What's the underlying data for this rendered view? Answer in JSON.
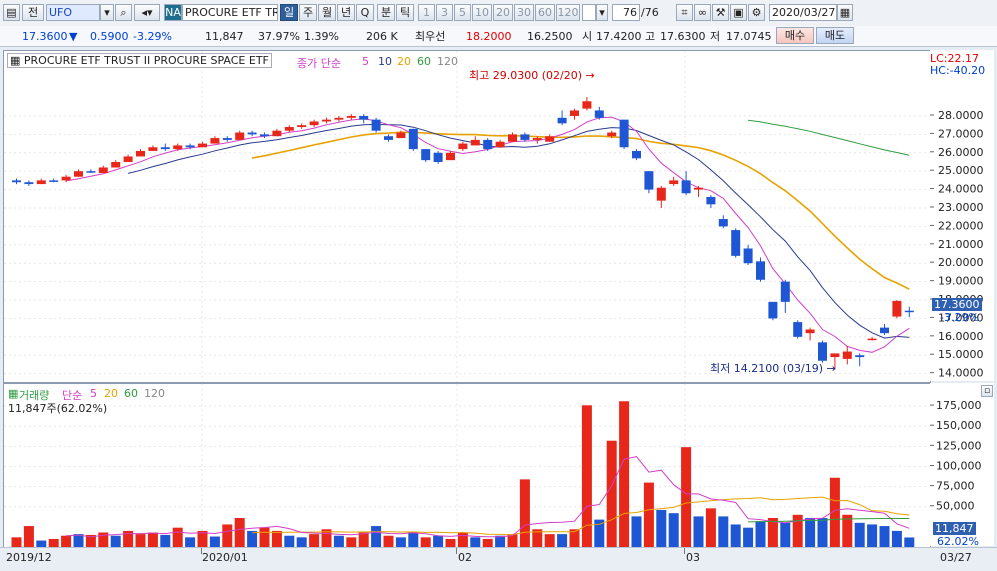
{
  "toolbar": {
    "chart_icon": "chart-icon",
    "period_label": "전",
    "symbol": "UFO",
    "market": "NA",
    "name": "PROCURE ETF TRUS",
    "tabs": [
      "일",
      "주",
      "월",
      "년",
      "Q",
      "분",
      "틱"
    ],
    "active_tab": "일",
    "intervals": [
      "1",
      "3",
      "5",
      "10",
      "20",
      "30",
      "60",
      "120"
    ],
    "count": "76",
    "count_total": "/76",
    "date": "2020/03/27"
  },
  "quote": {
    "price": "17.3600",
    "change": "0.5900",
    "change_pct": "-3.29%",
    "volume": "11,847",
    "vol_ratio": "37.97%",
    "rate": "1.39%",
    "turnover": "206 K",
    "bid_label": "최우선",
    "bid": "18.2000",
    "ask": "16.2500",
    "open_label": "시",
    "open": "17.4200",
    "high_label": "고",
    "high": "17.6300",
    "low_label": "저",
    "low": "17.0745",
    "buy_label": "매수",
    "sell_label": "매도"
  },
  "price_panel": {
    "title": "PROCURE ETF TRUST II PROCURE SPACE ETF",
    "legend_head": "종가 단순",
    "ma": [
      "5",
      "10",
      "20",
      "60",
      "120"
    ],
    "lc": "LC:22.17",
    "hc": "HC:-40.20",
    "high_note": "최고 29.0300 (02/20)",
    "low_note": "최저 14.2100 (03/19)",
    "last_price": "17.3600",
    "last_pct": "-3.29%"
  },
  "volume_panel": {
    "legend_head": "거래량",
    "legend_ma_head": "단순",
    "ma": [
      "5",
      "20",
      "60",
      "120"
    ],
    "info": "11,847주(62.02%)",
    "last_volume": "11,847",
    "last_pct": "62.02%"
  },
  "x_labels": [
    "2019/12",
    "2020/01",
    "02",
    "03",
    "03/27"
  ],
  "colors": {
    "up": "#e8271b",
    "down": "#1f56d4",
    "ma5": "#d23ec8",
    "ma10": "#2a3a8c",
    "ma20": "#e8a200",
    "ma60": "#2f9e3f"
  },
  "chart_data": {
    "type": "candlestick",
    "price_ylim": [
      13.6,
      29.9
    ],
    "price_ticks": [
      "14.0000",
      "15.0000",
      "16.0000",
      "17.0000",
      "18.0000",
      "19.0000",
      "20.0000",
      "21.0000",
      "22.0000",
      "23.0000",
      "24.0000",
      "25.0000",
      "26.0000",
      "27.0000",
      "28.0000"
    ],
    "volume_ylim": [
      0,
      190000
    ],
    "volume_ticks": [
      "50,000",
      "75,000",
      "100,000",
      "125,000",
      "150,000",
      "175,000"
    ],
    "candles": [
      [
        24.5,
        24.6,
        24.3,
        24.4
      ],
      [
        24.4,
        24.5,
        24.2,
        24.3
      ],
      [
        24.3,
        24.6,
        24.3,
        24.5
      ],
      [
        24.5,
        24.6,
        24.4,
        24.45
      ],
      [
        24.5,
        24.8,
        24.4,
        24.7
      ],
      [
        24.7,
        25.1,
        24.7,
        25.0
      ],
      [
        25.0,
        25.1,
        24.9,
        24.95
      ],
      [
        24.9,
        25.3,
        24.9,
        25.2
      ],
      [
        25.2,
        25.6,
        25.2,
        25.5
      ],
      [
        25.5,
        25.9,
        25.5,
        25.8
      ],
      [
        25.8,
        26.2,
        25.8,
        26.1
      ],
      [
        26.1,
        26.4,
        26.1,
        26.3
      ],
      [
        26.3,
        26.5,
        26.1,
        26.2
      ],
      [
        26.2,
        26.5,
        26.1,
        26.4
      ],
      [
        26.4,
        26.5,
        26.2,
        26.3
      ],
      [
        26.3,
        26.6,
        26.3,
        26.5
      ],
      [
        26.5,
        26.9,
        26.5,
        26.8
      ],
      [
        26.8,
        26.9,
        26.6,
        26.7
      ],
      [
        26.7,
        27.2,
        26.7,
        27.1
      ],
      [
        27.1,
        27.2,
        26.9,
        27.0
      ],
      [
        27.0,
        27.1,
        26.8,
        26.9
      ],
      [
        26.9,
        27.3,
        26.9,
        27.2
      ],
      [
        27.2,
        27.5,
        27.1,
        27.4
      ],
      [
        27.4,
        27.6,
        27.3,
        27.5
      ],
      [
        27.5,
        27.8,
        27.4,
        27.7
      ],
      [
        27.7,
        27.9,
        27.6,
        27.8
      ],
      [
        27.8,
        28.0,
        27.7,
        27.9
      ],
      [
        27.9,
        28.1,
        27.8,
        28.0
      ],
      [
        28.0,
        28.1,
        27.6,
        27.8
      ],
      [
        27.8,
        27.9,
        27.1,
        27.2
      ],
      [
        26.9,
        27.0,
        26.6,
        26.7
      ],
      [
        26.8,
        27.2,
        26.8,
        27.1
      ],
      [
        27.3,
        27.3,
        26.1,
        26.2
      ],
      [
        26.2,
        26.2,
        25.5,
        25.6
      ],
      [
        26.0,
        26.1,
        25.4,
        25.5
      ],
      [
        25.6,
        26.1,
        25.6,
        26.0
      ],
      [
        26.2,
        26.6,
        26.1,
        26.5
      ],
      [
        26.4,
        26.9,
        26.4,
        26.7
      ],
      [
        26.7,
        26.8,
        26.1,
        26.2
      ],
      [
        26.3,
        26.7,
        26.3,
        26.6
      ],
      [
        26.6,
        27.1,
        26.6,
        27.0
      ],
      [
        27.0,
        27.1,
        26.6,
        26.7
      ],
      [
        26.7,
        26.9,
        26.5,
        26.8
      ],
      [
        26.6,
        27.0,
        26.6,
        26.9
      ],
      [
        27.9,
        28.3,
        27.5,
        27.6
      ],
      [
        28.0,
        28.4,
        27.8,
        28.3
      ],
      [
        28.4,
        29.03,
        28.3,
        28.8
      ],
      [
        28.3,
        28.5,
        27.8,
        27.9
      ],
      [
        26.9,
        27.2,
        26.8,
        27.1
      ],
      [
        27.8,
        27.8,
        26.2,
        26.3
      ],
      [
        26.1,
        26.2,
        25.6,
        25.7
      ],
      [
        25.0,
        25.0,
        23.8,
        24.0
      ],
      [
        23.4,
        24.2,
        23.0,
        24.1
      ],
      [
        24.3,
        24.7,
        24.2,
        24.5
      ],
      [
        24.5,
        25.0,
        23.7,
        23.8
      ],
      [
        24.0,
        24.2,
        23.6,
        24.1
      ],
      [
        23.6,
        23.7,
        23.0,
        23.2
      ],
      [
        22.4,
        22.6,
        21.9,
        22.0
      ],
      [
        21.8,
        21.9,
        20.3,
        20.4
      ],
      [
        20.8,
        21.0,
        19.9,
        20.0
      ],
      [
        20.1,
        20.3,
        19.0,
        19.1
      ],
      [
        17.9,
        17.9,
        16.9,
        17.0
      ],
      [
        19.0,
        19.1,
        17.3,
        17.9
      ],
      [
        16.8,
        16.9,
        15.9,
        16.0
      ],
      [
        16.2,
        16.5,
        15.8,
        16.4
      ],
      [
        15.7,
        15.8,
        14.6,
        14.7
      ],
      [
        14.9,
        15.1,
        14.21,
        15.1
      ],
      [
        14.8,
        15.5,
        14.5,
        15.2
      ],
      [
        15.0,
        15.1,
        14.4,
        14.9
      ],
      [
        15.9,
        16.0,
        15.8,
        15.9
      ],
      [
        16.5,
        16.7,
        16.1,
        16.2
      ],
      [
        17.1,
        18.0,
        17.0,
        17.95
      ],
      [
        17.42,
        17.63,
        17.0745,
        17.36
      ]
    ],
    "volumes": [
      [
        12000,
        "up"
      ],
      [
        26000,
        "up"
      ],
      [
        8000,
        "down"
      ],
      [
        10000,
        "up"
      ],
      [
        14000,
        "up"
      ],
      [
        16000,
        "down"
      ],
      [
        15000,
        "up"
      ],
      [
        18000,
        "up"
      ],
      [
        14000,
        "down"
      ],
      [
        20000,
        "up"
      ],
      [
        16000,
        "up"
      ],
      [
        18000,
        "up"
      ],
      [
        15000,
        "down"
      ],
      [
        24000,
        "up"
      ],
      [
        12000,
        "down"
      ],
      [
        20000,
        "up"
      ],
      [
        13000,
        "down"
      ],
      [
        28000,
        "up"
      ],
      [
        36000,
        "up"
      ],
      [
        20000,
        "down"
      ],
      [
        24000,
        "up"
      ],
      [
        20000,
        "up"
      ],
      [
        14000,
        "down"
      ],
      [
        12000,
        "down"
      ],
      [
        16000,
        "up"
      ],
      [
        22000,
        "up"
      ],
      [
        14000,
        "down"
      ],
      [
        12000,
        "up"
      ],
      [
        18000,
        "up"
      ],
      [
        26000,
        "down"
      ],
      [
        14000,
        "up"
      ],
      [
        12000,
        "down"
      ],
      [
        18000,
        "down"
      ],
      [
        12000,
        "up"
      ],
      [
        14000,
        "down"
      ],
      [
        10000,
        "up"
      ],
      [
        18000,
        "up"
      ],
      [
        12000,
        "down"
      ],
      [
        10000,
        "up"
      ],
      [
        14000,
        "down"
      ],
      [
        16000,
        "up"
      ],
      [
        84000,
        "up"
      ],
      [
        22000,
        "up"
      ],
      [
        16000,
        "up"
      ],
      [
        16000,
        "down"
      ],
      [
        22000,
        "up"
      ],
      [
        176000,
        "up"
      ],
      [
        34000,
        "down"
      ],
      [
        132000,
        "up"
      ],
      [
        181000,
        "up"
      ],
      [
        38000,
        "down"
      ],
      [
        80000,
        "up"
      ],
      [
        46000,
        "down"
      ],
      [
        42000,
        "down"
      ],
      [
        124000,
        "up"
      ],
      [
        38000,
        "down"
      ],
      [
        48000,
        "up"
      ],
      [
        38000,
        "down"
      ],
      [
        28000,
        "down"
      ],
      [
        24000,
        "down"
      ],
      [
        32000,
        "down"
      ],
      [
        36000,
        "up"
      ],
      [
        30000,
        "down"
      ],
      [
        40000,
        "up"
      ],
      [
        36000,
        "down"
      ],
      [
        36000,
        "down"
      ],
      [
        86000,
        "up"
      ],
      [
        40000,
        "up"
      ],
      [
        30000,
        "down"
      ],
      [
        28000,
        "down"
      ],
      [
        26000,
        "down"
      ],
      [
        20000,
        "down"
      ],
      [
        11847,
        "down"
      ]
    ]
  }
}
